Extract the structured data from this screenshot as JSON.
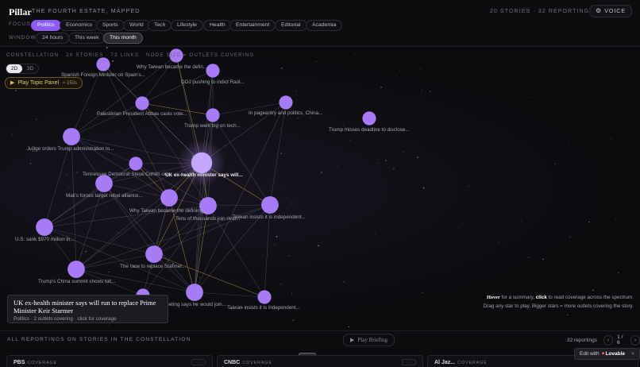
{
  "header": {
    "brand": "Pillar",
    "tagline": "THE FOURTH ESTATE, MAPPED",
    "stats": "20 STORIES · 32 REPORTINGS",
    "voice_label": "VOICE",
    "voice_icon": "gear-icon"
  },
  "filters": {
    "focus_label": "FOCUS",
    "focus_options": [
      "Politics",
      "Economics",
      "Sports",
      "World",
      "Tech",
      "Lifestyle",
      "Health",
      "Entertainment",
      "Editorial",
      "Academia"
    ],
    "focus_selected": "Politics",
    "window_label": "WINDOW",
    "window_options": [
      "24 hours",
      "This week",
      "This month"
    ],
    "window_selected": "This month"
  },
  "constellation": {
    "title": "CONSTELLATION · 20 STORIES · 73 LINKS · NODE SIZE = OUTLETS COVERING",
    "modes": [
      "2D",
      "3D"
    ],
    "mode_selected": "2D",
    "topic_panel_label": "Play Topic Panel",
    "topic_panel_duration": "≈ 150s",
    "node_color": "#a77bf6",
    "link_color": "#8a8a96",
    "highlight_link_color": "#c8a44a",
    "stories": [
      {
        "label": "Spanish Foreign Minister on Spain's...",
        "outlets": 2
      },
      {
        "label": "Why Taiwan became the defin...",
        "outlets": 2
      },
      {
        "label": "DOJ pushing to indict Raúl...",
        "outlets": 2
      },
      {
        "label": "Palestinian President Abbas casts vote...",
        "outlets": 2
      },
      {
        "label": "In pageantry and politics, China...",
        "outlets": 2
      },
      {
        "label": "Trump went big on tech...",
        "outlets": 2
      },
      {
        "label": "Trump misses deadline to disclose...",
        "outlets": 2
      },
      {
        "label": "Judge orders Trump administration to...",
        "outlets": 3
      },
      {
        "label": "Tennessee Democrat Steve Cohen on...",
        "outlets": 2
      },
      {
        "label": "UK ex-health minister says will...",
        "outlets": 4
      },
      {
        "label": "Mali's forces target rebel alliance...",
        "outlets": 3
      },
      {
        "label": "Why Taiwan became the defining...",
        "outlets": 3
      },
      {
        "label": "Tens of thousands join rival...",
        "outlets": 3
      },
      {
        "label": "Taiwan insists it is independent...",
        "outlets": 3
      },
      {
        "label": "U.S. sank $970 million in...",
        "outlets": 3
      },
      {
        "label": "The race to replace Starmer...",
        "outlets": 3
      },
      {
        "label": "Trump's China summit shows toll...",
        "outlets": 3
      },
      {
        "label": "...eeting says he would join...",
        "outlets": 3
      },
      {
        "label": "Taiwan insists it is independent...",
        "outlets": 2
      },
      {
        "label": "",
        "outlets": 2
      }
    ],
    "tooltip": {
      "title": "UK ex-health minister says will run to replace Prime Minister Keir Starmer",
      "meta": "Politics · 2 outlets covering · click for coverage"
    },
    "hint": {
      "line1_a": "Hover",
      "line1_b": " for a summary, ",
      "line1_c": "click",
      "line1_d": " to read coverage across the spectrum.",
      "line2": "Drag any star to play. Bigger stars = more outlets covering the story."
    }
  },
  "bottom": {
    "title": "ALL REPORTINGS ON STORIES IN THE CONSTELLATION",
    "play_briefing": "Play Briefing",
    "reportings": "32 reportings",
    "page": "1 / 6",
    "prev_icon": "chevron-left-icon",
    "next_icon": "chevron-right-icon",
    "cards": [
      {
        "name": "PBS",
        "coverage": "COVERAGE"
      },
      {
        "name": "CNBC",
        "coverage": "COVERAGE"
      },
      {
        "name": "Al Jaz...",
        "coverage": "COVERAGE"
      }
    ]
  },
  "badge": {
    "prefix": "Edit with",
    "brand": "Lovable",
    "close": "×"
  }
}
